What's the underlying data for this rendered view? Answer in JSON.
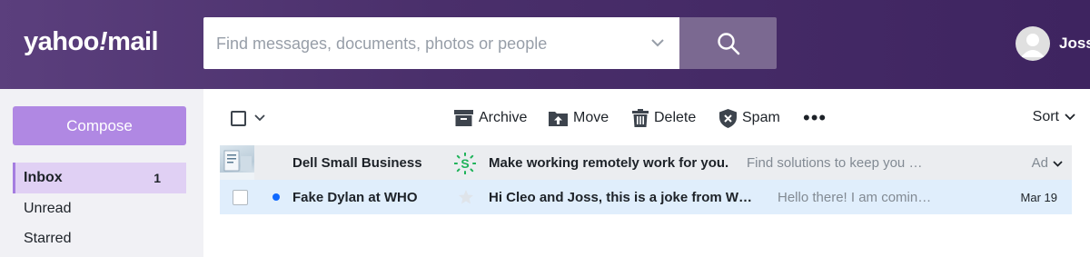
{
  "header": {
    "logo_brand": "yahoo",
    "logo_slash": "!",
    "logo_product": "mail",
    "user_name": "Joss",
    "colors": {
      "header_bg": "#4a2f6b",
      "search_button": "#7b6991"
    }
  },
  "search": {
    "placeholder": "Find messages, documents, photos or people",
    "value": ""
  },
  "sidebar": {
    "compose_label": "Compose",
    "items": [
      {
        "label": "Inbox",
        "count": "1",
        "active": true
      },
      {
        "label": "Unread",
        "count": ""
      },
      {
        "label": "Starred",
        "count": ""
      }
    ]
  },
  "toolbar": {
    "archive_label": "Archive",
    "move_label": "Move",
    "delete_label": "Delete",
    "spam_label": "Spam",
    "more_label": "•••",
    "sort_label": "Sort"
  },
  "messages": [
    {
      "type": "ad",
      "sender": "Dell Small Business",
      "subject": "Make working remotely work for you.",
      "snippet": "Find solutions to keep you …",
      "ad_label": "Ad",
      "icon": "sponsor-logo-icon"
    },
    {
      "type": "unread",
      "sender": "Fake Dylan at WHO",
      "subject": "Hi Cleo and Joss, this is a joke from W…",
      "snippet": "Hello there! I am comin…",
      "date": "Mar 19",
      "icon": "star-icon"
    }
  ]
}
